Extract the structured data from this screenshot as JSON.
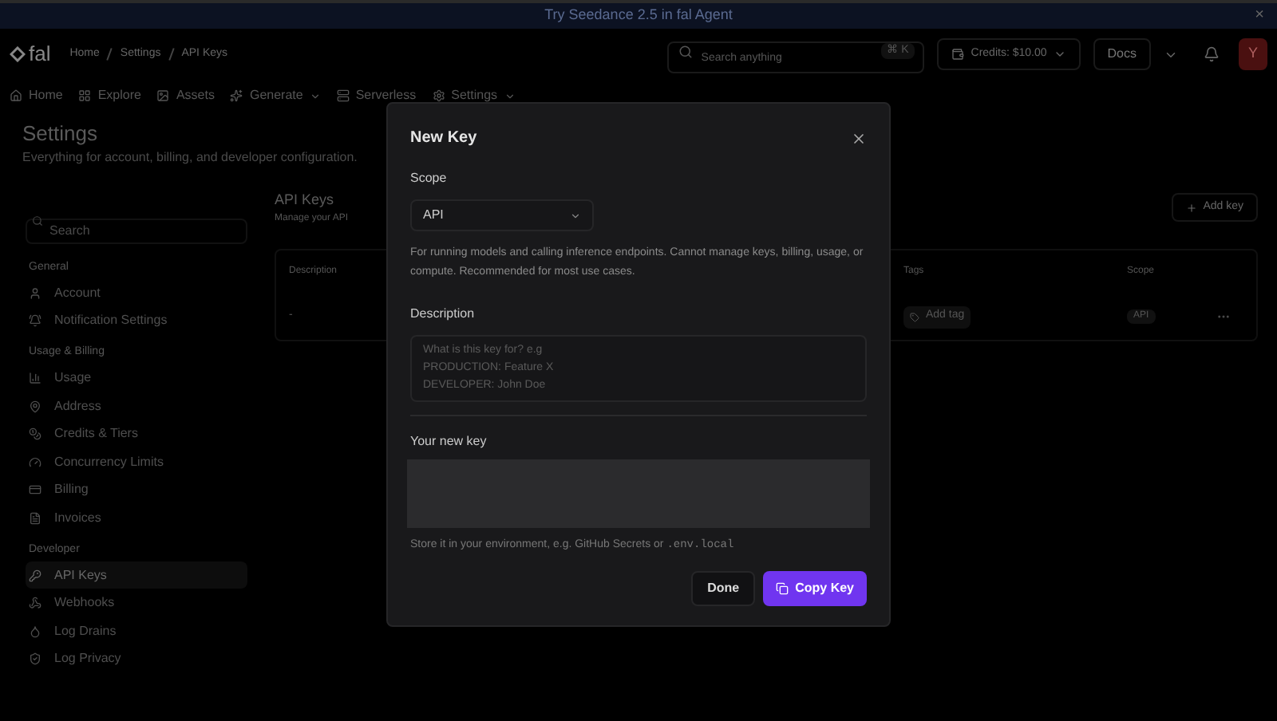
{
  "banner": {
    "text": "Try Seedance 2.5 in fal Agent",
    "close": "×"
  },
  "header": {
    "logo": "fal",
    "breadcrumbs": [
      "Home",
      "Settings",
      "API Keys"
    ],
    "search": {
      "placeholder": "Search anything",
      "shortcut": "⌘ K"
    },
    "credits": "Credits: $10.00",
    "docs": "Docs",
    "avatar": "Y"
  },
  "nav": [
    {
      "label": "Home",
      "kind": "link"
    },
    {
      "label": "Explore",
      "kind": "link"
    },
    {
      "label": "Assets",
      "kind": "link"
    },
    {
      "label": "Generate",
      "kind": "dropdown"
    },
    {
      "label": "Serverless",
      "kind": "link"
    },
    {
      "label": "Settings",
      "kind": "dropdown"
    }
  ],
  "page": {
    "title": "Settings",
    "subtitle": "Everything for account, billing, and developer configuration."
  },
  "sidebar": {
    "search": {
      "placeholder": "Search"
    },
    "sections": [
      {
        "heading": "General",
        "items": [
          {
            "label": "Account",
            "selected": false
          },
          {
            "label": "Notification Settings",
            "selected": false
          }
        ]
      },
      {
        "heading": "Usage & Billing",
        "items": [
          {
            "label": "Usage",
            "selected": false
          },
          {
            "label": "Address",
            "selected": false
          },
          {
            "label": "Credits & Tiers",
            "selected": false
          },
          {
            "label": "Concurrency Limits",
            "selected": false
          },
          {
            "label": "Billing",
            "selected": false
          },
          {
            "label": "Invoices",
            "selected": false
          }
        ]
      },
      {
        "heading": "Developer",
        "items": [
          {
            "label": "API Keys",
            "selected": true
          },
          {
            "label": "Webhooks",
            "selected": false
          },
          {
            "label": "Log Drains",
            "selected": false
          },
          {
            "label": "Log Privacy",
            "selected": false
          }
        ]
      }
    ]
  },
  "api_keys": {
    "title": "API Keys",
    "subtitle": "Manage your API",
    "add_button": "Add key",
    "table": {
      "columns": [
        "Description",
        "Tags",
        "Scope"
      ],
      "rows": [
        {
          "description": "-",
          "tag_button": "Add tag",
          "scope": "API"
        }
      ]
    }
  },
  "modal": {
    "title": "New Key",
    "scope_label": "Scope",
    "scope_value": "API",
    "scope_help": "For running models and calling inference endpoints. Cannot manage keys, billing, usage, or compute. Recommended for most use cases.",
    "description_label": "Description",
    "description_placeholder": "What is this key for? e.g\nPRODUCTION: Feature X\nDEVELOPER: John Doe",
    "key_label": "Your new key",
    "key_hint": "Store it in your environment, e.g. GitHub Secrets or",
    "key_hint_code": ".env.local",
    "buttons": [
      {
        "label": "Done",
        "kind": "secondary"
      },
      {
        "label": "Copy Key",
        "kind": "primary"
      }
    ]
  }
}
